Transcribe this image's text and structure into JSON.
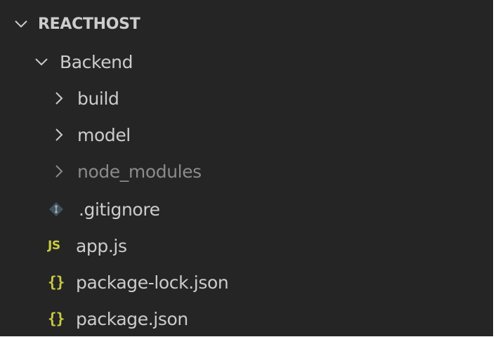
{
  "colors": {
    "panel_bg": "#252526",
    "text": "#cccccc",
    "dimmed_text": "#8b8b8b",
    "js_icon": "#cbcb41",
    "json_icon": "#cbcb41",
    "gitignore_icon": "#41535b"
  },
  "explorer": {
    "section_title": "REACTHOST",
    "section_expanded": true,
    "folder": {
      "name": "Backend",
      "expanded": true,
      "children": [
        {
          "name": "build",
          "kind": "folder",
          "expanded": false,
          "dimmed": false,
          "icon": "chevron-right-icon"
        },
        {
          "name": "model",
          "kind": "folder",
          "expanded": false,
          "dimmed": false,
          "icon": "chevron-right-icon"
        },
        {
          "name": "node_modules",
          "kind": "folder",
          "expanded": false,
          "dimmed": true,
          "icon": "chevron-right-icon"
        },
        {
          "name": ".gitignore",
          "kind": "file",
          "icon": "git-diamond-icon"
        },
        {
          "name": "app.js",
          "kind": "file",
          "icon": "js-icon",
          "icon_text": "JS"
        },
        {
          "name": "package-lock.json",
          "kind": "file",
          "icon": "json-braces-icon",
          "icon_text": "{}"
        },
        {
          "name": "package.json",
          "kind": "file",
          "icon": "json-braces-icon",
          "icon_text": "{}"
        }
      ]
    }
  }
}
